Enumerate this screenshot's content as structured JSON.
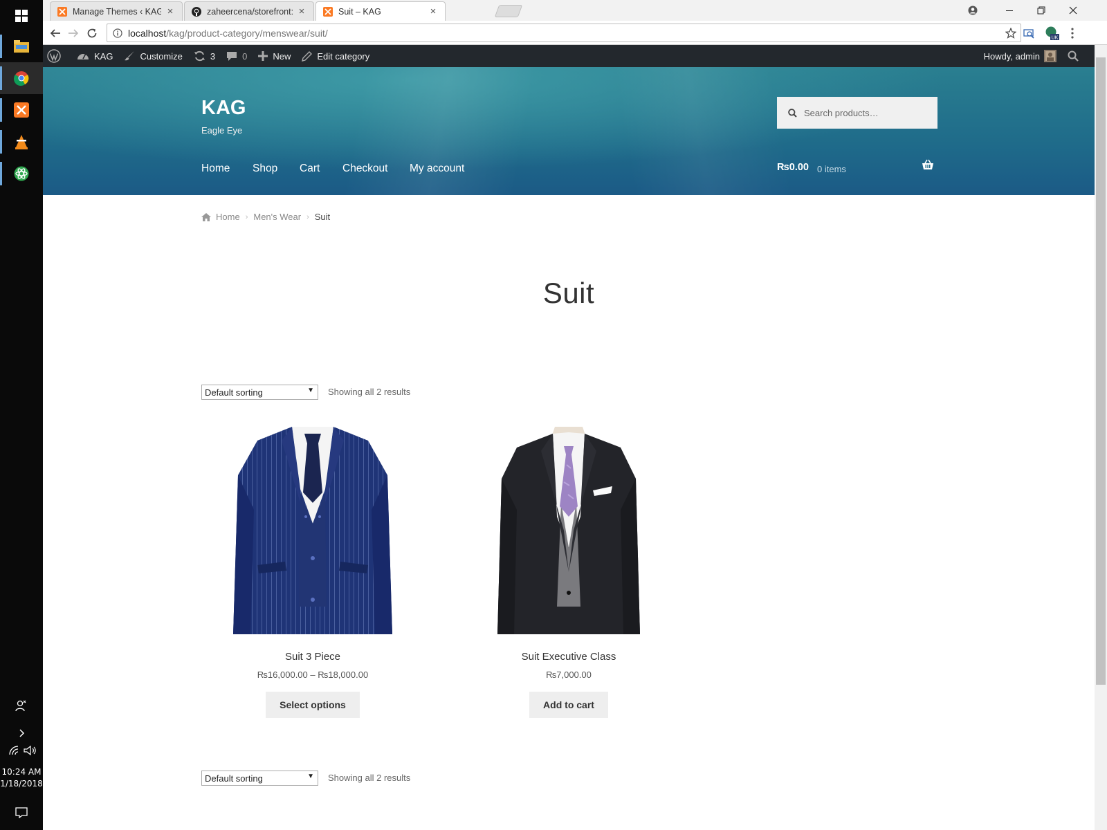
{
  "taskbar": {
    "clock_time": "10:24 AM",
    "clock_date": "1/18/2018"
  },
  "browser": {
    "tabs": [
      {
        "title": "Manage Themes ‹ KAG —",
        "active": false
      },
      {
        "title": "zaheercena/storefront: C",
        "active": false
      },
      {
        "title": "Suit – KAG",
        "active": true
      }
    ],
    "url_host": "localhost",
    "url_path": "/kag/product-category/menswear/suit/",
    "extension_badge": "UK"
  },
  "adminbar": {
    "site_name": "KAG",
    "customize": "Customize",
    "updates_count": "3",
    "comments_count": "0",
    "new": "New",
    "edit_category": "Edit category",
    "howdy": "Howdy, admin"
  },
  "header": {
    "site_title": "KAG",
    "site_description": "Eagle Eye",
    "search_placeholder": "Search products…",
    "nav": [
      "Home",
      "Shop",
      "Cart",
      "Checkout",
      "My account"
    ],
    "cart_amount": "₨0.00",
    "cart_items": "0 items"
  },
  "breadcrumb": {
    "home": "Home",
    "parent": "Men's Wear",
    "current": "Suit"
  },
  "page": {
    "title": "Suit",
    "sort_label": "Default sorting",
    "result_count": "Showing all 2 results"
  },
  "products": [
    {
      "name": "Suit 3 Piece",
      "price": "₨16,000.00 – ₨18,000.00",
      "button": "Select options",
      "image": "navy-pinstripe-suit"
    },
    {
      "name": "Suit Executive Class",
      "price": "₨7,000.00",
      "button": "Add to cart",
      "image": "charcoal-suit-purple-tie"
    }
  ],
  "colors": {
    "adminbar": "#23282d",
    "header": "#1f6b8a",
    "button_bg": "#eeeeee"
  }
}
